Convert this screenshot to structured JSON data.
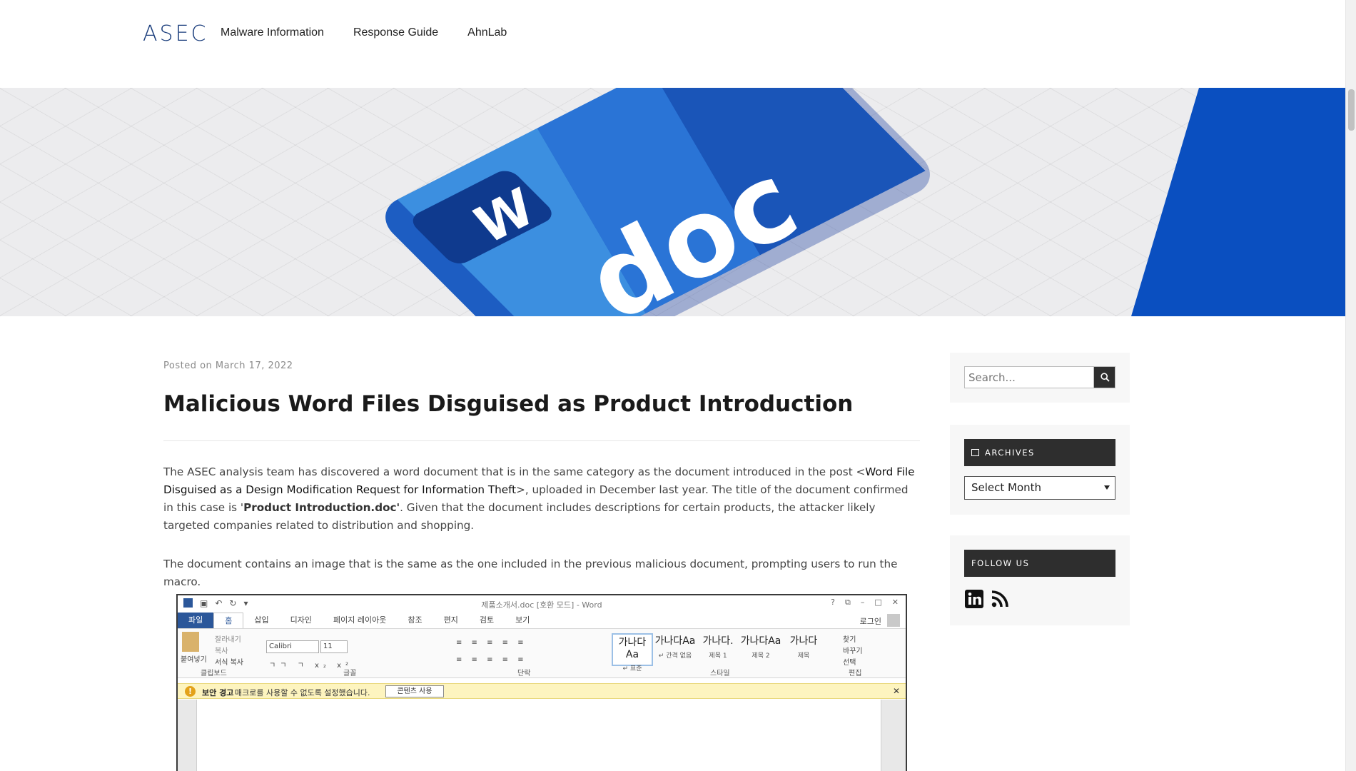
{
  "header": {
    "logo_text": "ASEC",
    "nav": [
      "Malware Information",
      "Response Guide",
      "AhnLab"
    ]
  },
  "hero": {
    "icon_letter": "W",
    "label": "doc",
    "colors": {
      "blue_light": "#3c8fe0",
      "blue": "#1f63c4",
      "blue_dark": "#1247a3",
      "accent_band": "#0a4fc0"
    }
  },
  "post": {
    "meta_prefix": "Posted on",
    "date": "March 17, 2022",
    "title": "Malicious Word Files Disguised as Product Introduction",
    "p1_a": "The ASEC analysis team has discovered a word document that is in the same category as the document introduced in the post <",
    "p1_link": "Word File Disguised as a Design Modification Request for Information Theft",
    "p1_b": ">, uploaded in December last year. The title of the document confirmed in this case is '",
    "p1_bold": "Product Introduction.doc'",
    "p1_c": ". Given that the document includes descriptions for certain products, the attacker likely targeted companies related to distribution and shopping.",
    "p2": "The document contains an image that is the same as the one included in the previous malicious document, prompting users to run the macro."
  },
  "word_screenshot": {
    "title": "제품소개서.doc [호환 모드] - Word",
    "win_controls": [
      "?",
      "⧉",
      "–",
      "□",
      "✕"
    ],
    "tabs": [
      "파일",
      "홈",
      "삽입",
      "디자인",
      "페이지 레이아웃",
      "참조",
      "편지",
      "검토",
      "보기"
    ],
    "login": "로그인",
    "clipboard": {
      "paste": "붙여넣기",
      "cut": "잘라내기",
      "copy": "복사",
      "format_painter": "서식 복사"
    },
    "font_name": "Calibri",
    "font_size": "11",
    "styles": [
      {
        "preview": "가나다Aa",
        "name": "↵ 표준"
      },
      {
        "preview": "가나다Aa",
        "name": "↵ 간격 없음"
      },
      {
        "preview": "가나다.",
        "name": "제목 1"
      },
      {
        "preview": "가나다Aa",
        "name": "제목 2"
      },
      {
        "preview": "가나다",
        "name": "제목"
      }
    ],
    "editing": {
      "find": "찾기",
      "replace": "바꾸기",
      "select": "선택"
    },
    "group_labels": [
      "클립보드",
      "글꼴",
      "단락",
      "스타일",
      "편집"
    ],
    "warning_title": "보안 경고",
    "warning_text": "매크로를 사용할 수 없도록 설정했습니다.",
    "warning_button": "콘텐츠 사용"
  },
  "sidebar": {
    "search_placeholder": "Search...",
    "archives_title": "ARCHIVES",
    "archives_select": "Select Month",
    "follow_title": "FOLLOW US",
    "social": [
      "linkedin-icon",
      "rss-icon"
    ]
  }
}
